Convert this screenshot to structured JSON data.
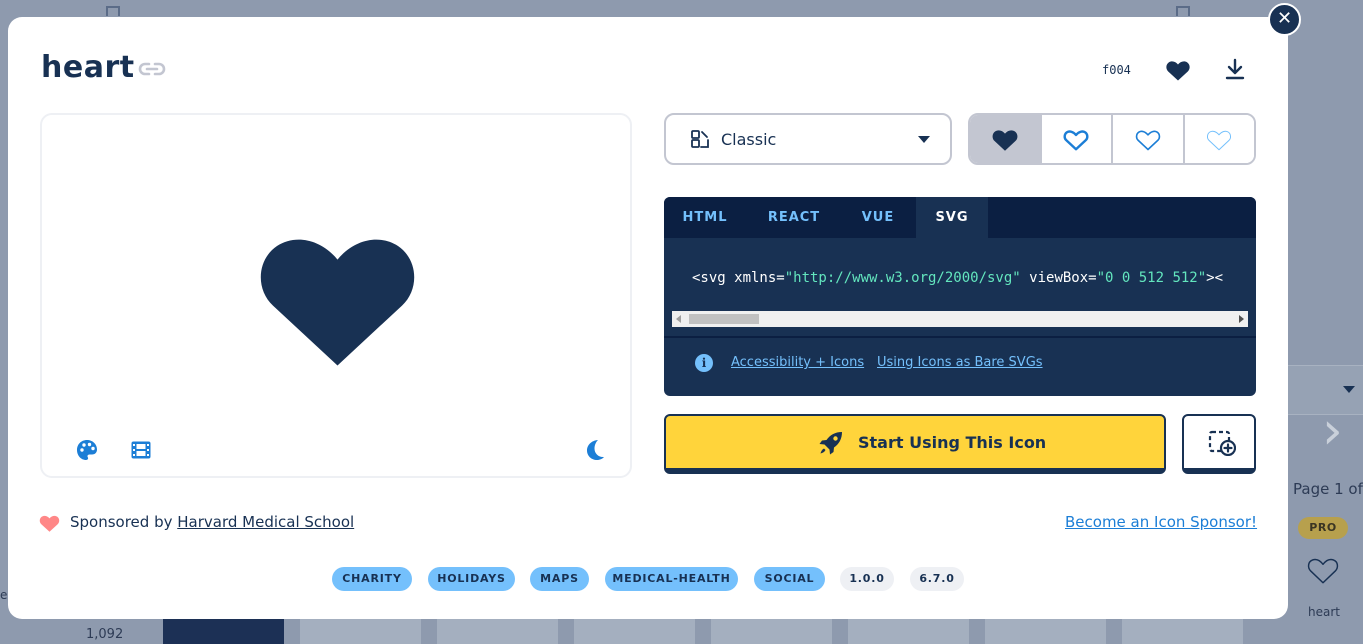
{
  "background": {
    "pagination_text": "Page 1 of",
    "pro_badge": "PRO",
    "icon_label": "heart",
    "count": "1,092",
    "partial_letter": "e"
  },
  "modal": {
    "title": "heart",
    "unicode": "f004",
    "style_selector": {
      "selected": "Classic",
      "icon": "shapes-icon"
    },
    "variants": [
      {
        "name": "solid",
        "active": true
      },
      {
        "name": "regular",
        "active": false
      },
      {
        "name": "light",
        "active": false
      },
      {
        "name": "thin",
        "active": false
      }
    ],
    "code_tabs": [
      "HTML",
      "REACT",
      "VUE",
      "SVG"
    ],
    "active_tab": "SVG",
    "code": {
      "prefix": "<svg xmlns=",
      "xmlns": "\"http://www.w3.org/2000/svg\"",
      "attr": " viewBox=",
      "viewbox": "\"0 0 512 512\"",
      "suffix": "><"
    },
    "code_links": [
      "Accessibility + Icons",
      "Using Icons as Bare SVGs"
    ],
    "start_button": "Start Using This Icon",
    "sponsor": {
      "prefix": "Sponsored by ",
      "name": "Harvard Medical School"
    },
    "become_sponsor": "Become an Icon Sponsor!",
    "category_tags": [
      "CHARITY",
      "HOLIDAYS",
      "MAPS",
      "MEDICAL-HEALTH",
      "SOCIAL"
    ],
    "version_tags": [
      "1.0.0",
      "6.7.0"
    ]
  },
  "colors": {
    "navy": "#183153",
    "yellow": "#ffd43b",
    "sky": "#74c0fc",
    "link_blue": "#1c7ed6",
    "sponsor_heart": "#ff8787"
  }
}
